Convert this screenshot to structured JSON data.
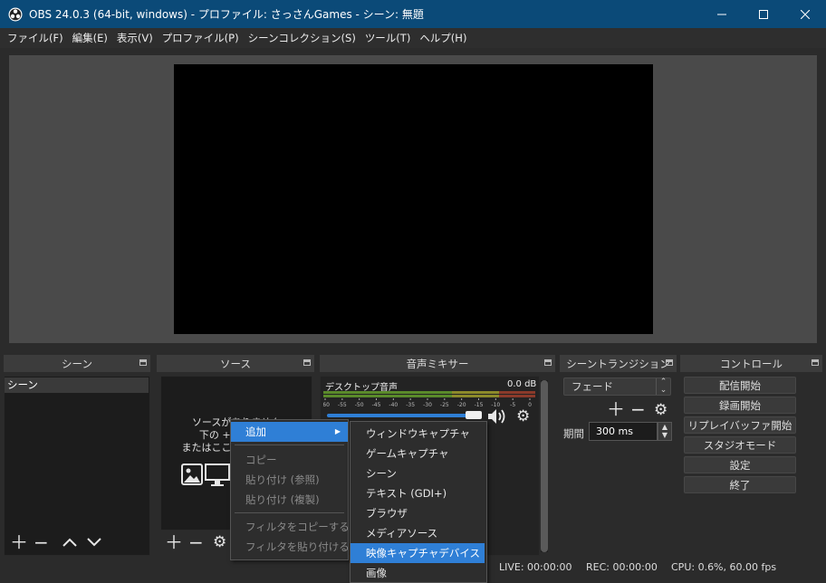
{
  "window": {
    "title": "OBS 24.0.3 (64-bit, windows) - プロファイル: さっさんGames - シーン: 無題"
  },
  "menu": [
    "ファイル(F)",
    "編集(E)",
    "表示(V)",
    "プロファイル(P)",
    "シーンコレクション(S)",
    "ツール(T)",
    "ヘルプ(H)"
  ],
  "docks": {
    "scenes": "シーン",
    "sources": "ソース",
    "mixer": "音声ミキサー",
    "transitions": "シーントランジション",
    "controls": "コントロール"
  },
  "scenes": {
    "items": [
      "シーン"
    ]
  },
  "sources": {
    "empty_line1": "ソースがありません",
    "empty_line2": "下の + ボタンを",
    "empty_line3": "またはここを右クリック"
  },
  "mixer": {
    "channel": "デスクトップ音声",
    "level": "0.0 dB",
    "ticks": [
      "-60",
      "-55",
      "-50",
      "-45",
      "-40",
      "-35",
      "-30",
      "-25",
      "-20",
      "-15",
      "-10",
      "-5",
      "0"
    ],
    "volume_fraction": 1.0
  },
  "transitions": {
    "selected": "フェード",
    "duration_label": "期間",
    "duration_value": "300 ms"
  },
  "controls": [
    "配信開始",
    "録画開始",
    "リプレイバッファ開始",
    "スタジオモード",
    "設定",
    "終了"
  ],
  "context_menu": {
    "items": [
      "追加",
      "コピー",
      "貼り付け (参照)",
      "貼り付け (複製)",
      "フィルタをコピーする",
      "フィルタを貼り付ける"
    ]
  },
  "submenu": {
    "items": [
      "ウィンドウキャプチャ",
      "ゲームキャプチャ",
      "シーン",
      "テキスト (GDI+)",
      "ブラウザ",
      "メディアソース",
      "映像キャプチャデバイス",
      "画像"
    ],
    "highlighted": "映像キャプチャデバイス"
  },
  "status": {
    "live": "LIVE: 00:00:00",
    "rec": "REC: 00:00:00",
    "cpu": "CPU: 0.6%, 60.00 fps"
  },
  "colors": {
    "titlebar": "#0b4a78",
    "highlight": "#2f7fd6"
  }
}
